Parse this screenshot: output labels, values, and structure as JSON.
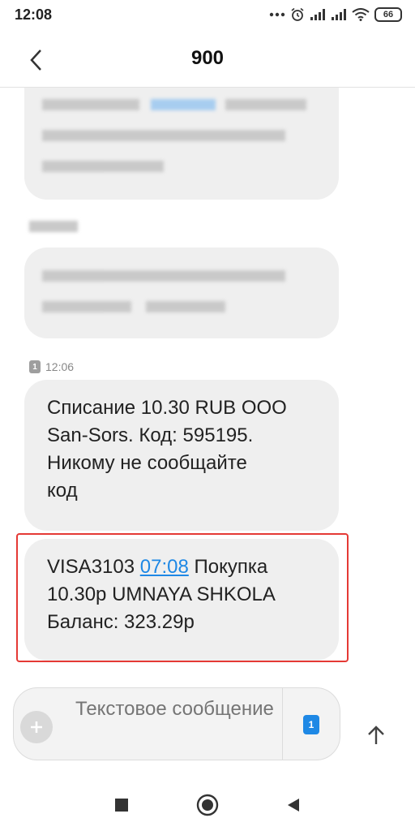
{
  "status_bar": {
    "time": "12:08",
    "battery": "66",
    "icons": [
      "more-icon",
      "alarm-icon",
      "signal-icon",
      "signal-icon",
      "wifi-icon",
      "battery-icon"
    ]
  },
  "header": {
    "title": "900",
    "back_icon": "chevron-left-icon"
  },
  "messages": {
    "timestamp": "12:06",
    "sim_slot": "1",
    "message1": {
      "line1": "Списание 10.30 RUB ООО",
      "line2": "San-Sors. Код: 595195.",
      "line3": "Никому не сообщайте",
      "line4": "код"
    },
    "message2": {
      "prefix": "VISA3103 ",
      "time_link": "07:08",
      "after_link": " Покупка",
      "line2": "10.30р UMNAYA SHKOLA",
      "line3": "Баланс: 323.29р"
    },
    "highlight_color": "#e53935"
  },
  "composer": {
    "placeholder": "Текстовое сообщение",
    "sim_slot": "1",
    "accent": "#1e88e5"
  },
  "nav_bar": {
    "icons": [
      "recents-square-icon",
      "home-circle-icon",
      "back-triangle-icon"
    ]
  }
}
